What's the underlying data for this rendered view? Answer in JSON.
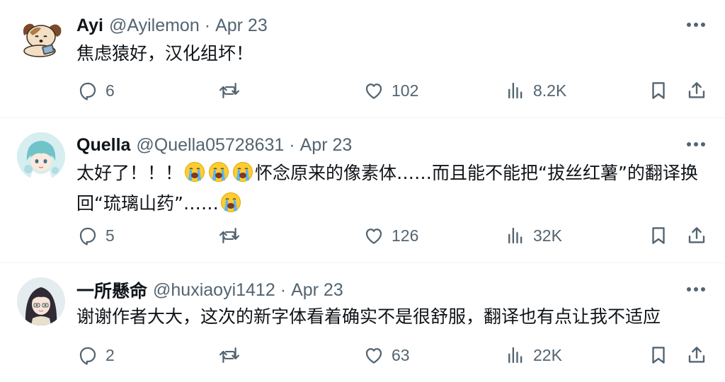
{
  "colors": {
    "text_primary": "#0f1419",
    "text_secondary": "#536471",
    "divider": "#eff3f4"
  },
  "tweets": [
    {
      "name": "Ayi",
      "handle": "@Ayilemon",
      "separator": "·",
      "date": "Apr 23",
      "text": "焦虑猿好，汉化组坏！",
      "emoji_count": 0,
      "avatar_icon": "dog-lying-avatar",
      "replies": "6",
      "reposts": "",
      "likes": "102",
      "views": "8.2K"
    },
    {
      "name": "Quella",
      "handle": "@Quella05728631",
      "separator": "·",
      "date": "Apr 23",
      "text_line1_a": "太好了！！！",
      "text_line1_b": "怀念原来的像素体……而且能不能把“拔丝红薯”的翻译换",
      "text_line2": "回“琉璃山药”……",
      "emoji": "loudly-crying-face",
      "avatar_icon": "anime-girl-teal-hair-avatar",
      "replies": "5",
      "reposts": "",
      "likes": "126",
      "views": "32K"
    },
    {
      "name": "一所懸命",
      "handle": "@huxiaoyi1412",
      "separator": "·",
      "date": "Apr 23",
      "text": "谢谢作者大大，这次的新字体看着确实不是很舒服，翻译也有点让我不适应",
      "avatar_icon": "anime-girl-dark-hair-avatar",
      "replies": "2",
      "reposts": "",
      "likes": "63",
      "views": "22K"
    }
  ],
  "icons": {
    "more": "more-dots-icon",
    "reply": "reply-bubble-icon",
    "repost": "repost-arrows-icon",
    "like": "heart-icon",
    "views": "views-bar-chart-icon",
    "bookmark": "bookmark-icon",
    "share": "share-upload-icon"
  }
}
